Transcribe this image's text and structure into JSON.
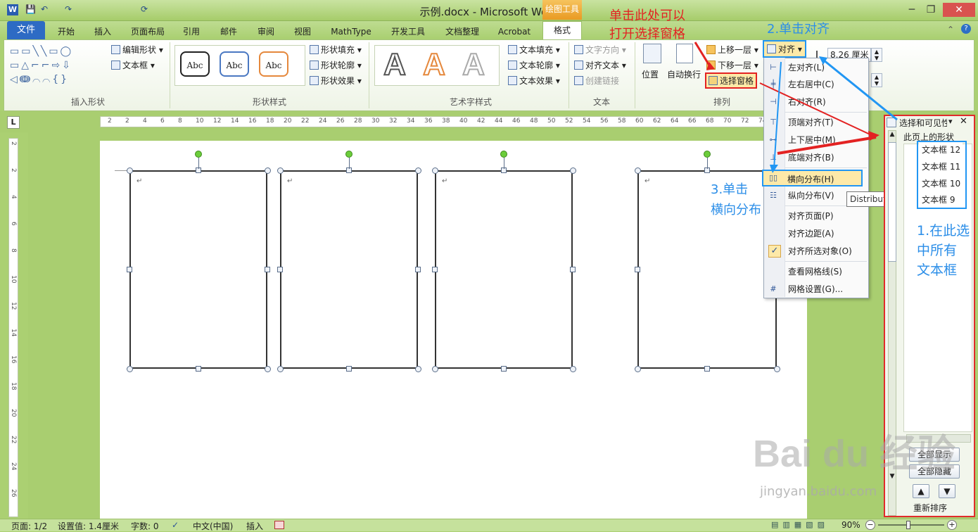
{
  "window": {
    "title": "示例.docx - Microsoft Word"
  },
  "quick_access": [
    "W",
    "💾",
    "↶",
    "↷",
    "⟳"
  ],
  "context_tab": {
    "label": "绘图工具"
  },
  "tabs": [
    {
      "label": "文件"
    },
    {
      "label": "开始"
    },
    {
      "label": "插入"
    },
    {
      "label": "页面布局"
    },
    {
      "label": "引用"
    },
    {
      "label": "邮件"
    },
    {
      "label": "审阅"
    },
    {
      "label": "视图"
    },
    {
      "label": "MathType"
    },
    {
      "label": "开发工具"
    },
    {
      "label": "文档整理"
    },
    {
      "label": "Acrobat"
    },
    {
      "label": "格式"
    }
  ],
  "ribbon": {
    "groups": {
      "insert_shapes": "插入形状",
      "shape_styles": "形状样式",
      "wordart_styles": "艺术字样式",
      "text": "文本",
      "arrange": "排列"
    },
    "edit_shape": "编辑形状",
    "text_box": "文本框",
    "abc": "Abc",
    "shape_fill": "形状填充",
    "shape_outline": "形状轮廓",
    "shape_effects": "形状效果",
    "wordart_letter": "A",
    "text_fill": "文本填充",
    "text_outline": "文本轮廓",
    "text_effects": "文本效果",
    "text_direction": "文字方向",
    "align_text": "对齐文本",
    "create_link": "创建链接",
    "position": "位置",
    "wrap_text": "自动换行",
    "bring_forward": "上移一层",
    "send_backward": "下移一层",
    "selection_pane": "选择窗格",
    "align": "对齐",
    "height_value": "8.26 厘米"
  },
  "ruler_h": [
    "2",
    "2",
    "4",
    "6",
    "8",
    "10",
    "12",
    "14",
    "16",
    "18",
    "20",
    "22",
    "24",
    "26",
    "28",
    "30",
    "32",
    "34",
    "36",
    "38",
    "40",
    "42",
    "44",
    "46",
    "48",
    "50",
    "52",
    "54",
    "56",
    "58",
    "60",
    "62",
    "64",
    "66",
    "68",
    "70",
    "72",
    "74",
    "76",
    "78"
  ],
  "ruler_v": [
    "2",
    "2",
    "4",
    "6",
    "8",
    "10",
    "12",
    "14",
    "16",
    "18",
    "20",
    "22",
    "24",
    "26"
  ],
  "align_menu": [
    {
      "label": "左对齐(L)",
      "icon": "⊢"
    },
    {
      "label": "左右居中(C)",
      "icon": "╪"
    },
    {
      "label": "右对齐(R)",
      "icon": "⊣"
    },
    {
      "label": "顶端对齐(T)",
      "icon": "⊤"
    },
    {
      "label": "上下居中(M)",
      "icon": "⊶"
    },
    {
      "label": "底端对齐(B)",
      "icon": "⊥"
    },
    {
      "label": "横向分布(H)",
      "icon": "▯▯"
    },
    {
      "label": "纵向分布(V)",
      "icon": "☷"
    },
    {
      "label": "对齐页面(P)",
      "icon": ""
    },
    {
      "label": "对齐边距(A)",
      "icon": ""
    },
    {
      "label": "对齐所选对象(O)",
      "icon": "✓"
    },
    {
      "label": "查看网格线(S)",
      "icon": ""
    },
    {
      "label": "网格设置(G)...",
      "icon": "#"
    }
  ],
  "tooltip": "Distribute Horizontally",
  "selection_pane": {
    "title": "选择和可见性",
    "shapes_label": "此页上的形状",
    "items": [
      "文本框 12",
      "文本框 11",
      "文本框 10",
      "文本框 9"
    ],
    "show_all": "全部显示",
    "hide_all": "全部隐藏",
    "reorder": "重新排序"
  },
  "annotations": {
    "selection_pane_hint_line1": "单击此处可以",
    "selection_pane_hint_line2": "打开选择窗格",
    "step2": "2.单击对齐",
    "step3_line1": "3.单击",
    "step3_line2": "横向分布",
    "step1_line1": "1.在此选",
    "step1_line2": "中所有",
    "step1_line3": "文本框"
  },
  "status_bar": {
    "page": "页面: 1/2",
    "settings": "设置值: 1.4厘米",
    "words": "字数: 0",
    "language": "中文(中国)",
    "mode": "插入",
    "zoom": "90%"
  },
  "watermark": {
    "brand": "Bai du 经验",
    "url": "jingyan.baidu.com"
  }
}
